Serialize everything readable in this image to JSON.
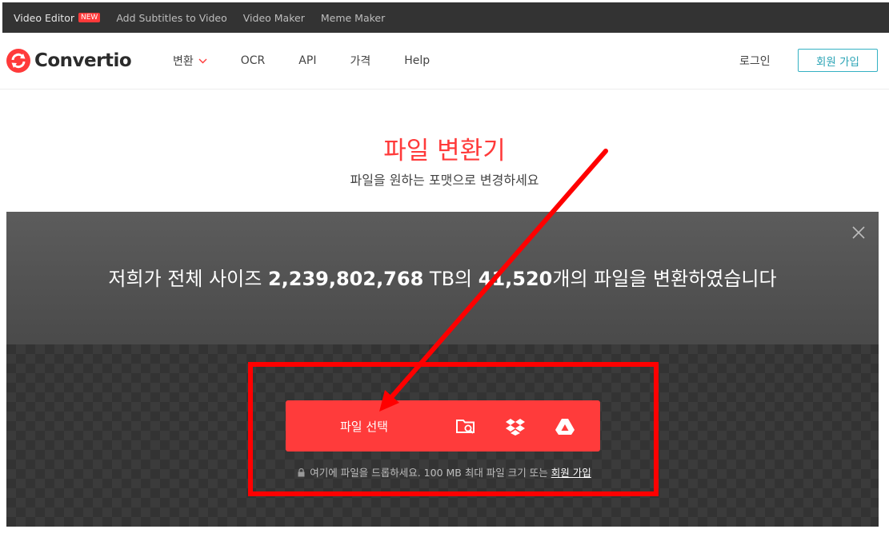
{
  "topbar": {
    "items": [
      {
        "label": "Video Editor",
        "badge": "NEW"
      },
      {
        "label": "Add Subtitles to Video"
      },
      {
        "label": "Video Maker"
      },
      {
        "label": "Meme Maker"
      }
    ]
  },
  "header": {
    "logo_text": "Convertio",
    "nav": [
      {
        "label": "변환",
        "has_dropdown": true
      },
      {
        "label": "OCR"
      },
      {
        "label": "API"
      },
      {
        "label": "가격"
      },
      {
        "label": "Help"
      }
    ],
    "login_label": "로그인",
    "signup_label": "회원 가입"
  },
  "hero": {
    "title": "파일 변환기",
    "subtitle": "파일을 원하는 포맷으로 변경하세요"
  },
  "stats": {
    "prefix": "저희가 전체 사이즈 ",
    "size_value": "2,239,802,768",
    "size_unit": " TB의 ",
    "file_count": "41,520",
    "suffix": "개의 파일을 변환하였습니다"
  },
  "upload": {
    "button_label": "파일 선택",
    "sources": [
      "folder-search-icon",
      "dropbox-icon",
      "google-drive-icon"
    ],
    "hint_prefix": "여기에 파일을 드롭하세요. 100 MB 최대 파일 크기 또는 ",
    "hint_link": "회원 가입"
  },
  "colors": {
    "accent": "#ff3a3a",
    "topbar_bg": "#333333",
    "signup_border": "#34b1c3",
    "annotation_red": "#ff0000"
  }
}
